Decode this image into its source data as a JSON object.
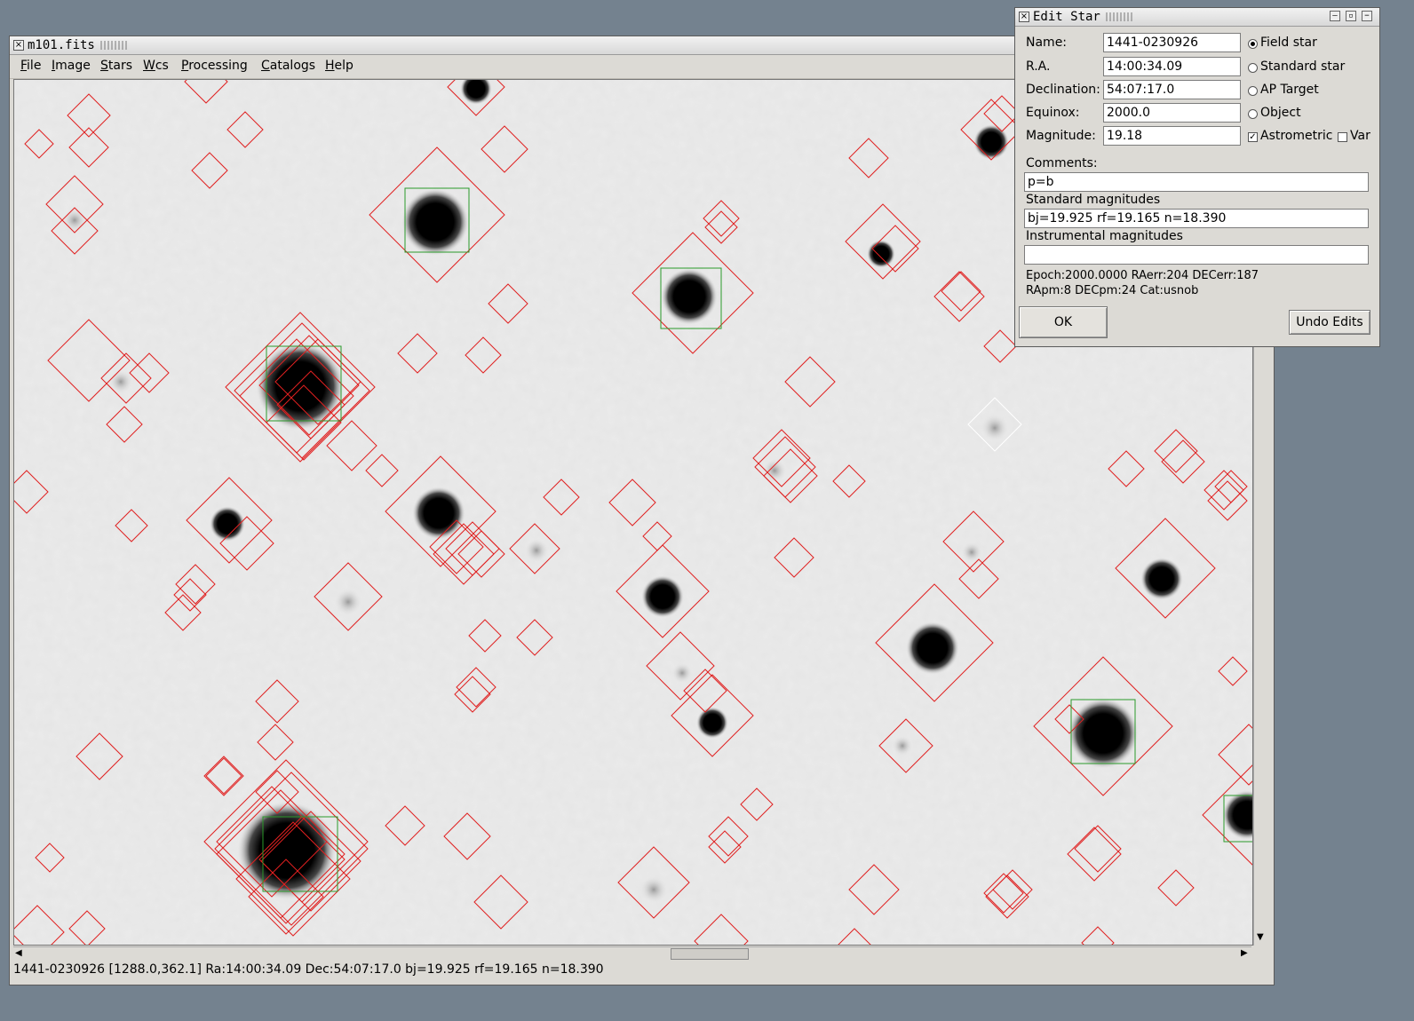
{
  "main_window": {
    "title": "m101.fits",
    "menu": [
      "File",
      "Image",
      "Stars",
      "Wcs",
      "Processing",
      "Catalogs",
      "Help"
    ],
    "status": "1441-0230926 [1288.0,362.1] Ra:14:00:34.09 Dec:54:07:17.0 bj=19.925 rf=19.165 n=18.390"
  },
  "dialog": {
    "title": "Edit Star",
    "fields": {
      "name_label": "Name:",
      "name_value": "1441-0230926",
      "ra_label": "R.A.",
      "ra_value": "14:00:34.09",
      "dec_label": "Declination:",
      "dec_value": "54:07:17.0",
      "equinox_label": "Equinox:",
      "equinox_value": "2000.0",
      "mag_label": "Magnitude:",
      "mag_value": "19.18"
    },
    "options": {
      "field_star": "Field star",
      "standard_star": "Standard star",
      "ap_target": "AP Target",
      "object": "Object",
      "astrometric": "Astrometric",
      "var": "Var"
    },
    "comments_label": "Comments:",
    "comments_value": "p=b",
    "std_mag_label": "Standard magnitudes",
    "std_mag_value": "bj=19.925 rf=19.165 n=18.390",
    "inst_mag_label": "Instrumental magnitudes",
    "inst_mag_value": "",
    "info_line1": "Epoch:2000.0000 RAerr:204 DECerr:187",
    "info_line2": "RApm:8 DECpm:24 Cat:usnob",
    "ok_label": "OK",
    "undo_label": "Undo Edits"
  },
  "colors": {
    "catalog_marker": "#e02020",
    "detected_marker": "#2a9a2a",
    "selected_marker": "#ffffff"
  }
}
